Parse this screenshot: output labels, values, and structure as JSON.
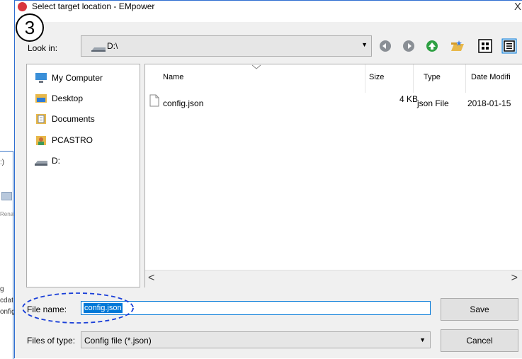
{
  "dialog": {
    "title": "Select target location - EMpower",
    "close_glyph": "X"
  },
  "annotation": {
    "step_number": "3"
  },
  "background_window": {
    "fragments": [
      ":)",
      "Renai",
      "g",
      "cdat",
      "onfig."
    ]
  },
  "look_in": {
    "label": "Look in:",
    "value": "D:\\",
    "drive_icon": "drive-icon"
  },
  "toolbar": {
    "icons": [
      "back-icon",
      "forward-icon",
      "up-folder-icon",
      "new-folder-icon",
      "view-menu-icon",
      "details-view-icon"
    ]
  },
  "places": [
    {
      "label": "My Computer",
      "icon": "computer-icon"
    },
    {
      "label": "Desktop",
      "icon": "desktop-folder-icon"
    },
    {
      "label": "Documents",
      "icon": "documents-icon"
    },
    {
      "label": "PCASTRO",
      "icon": "user-icon"
    },
    {
      "label": "D:",
      "icon": "drive-icon"
    }
  ],
  "file_list": {
    "columns": [
      "Name",
      "Size",
      "Type",
      "Date Modifi"
    ],
    "rows": [
      {
        "name": "config.json",
        "size": "4 KB",
        "type": "json File",
        "date": "2018-01-15"
      }
    ]
  },
  "file_name": {
    "label": "File name:",
    "value": "config.json"
  },
  "file_type": {
    "label": "Files of type:",
    "value": "Config file (*.json)"
  },
  "buttons": {
    "save": "Save",
    "cancel": "Cancel"
  },
  "colors": {
    "accent": "#0078d7",
    "border": "#2f6fd1",
    "badge": "#000000"
  }
}
